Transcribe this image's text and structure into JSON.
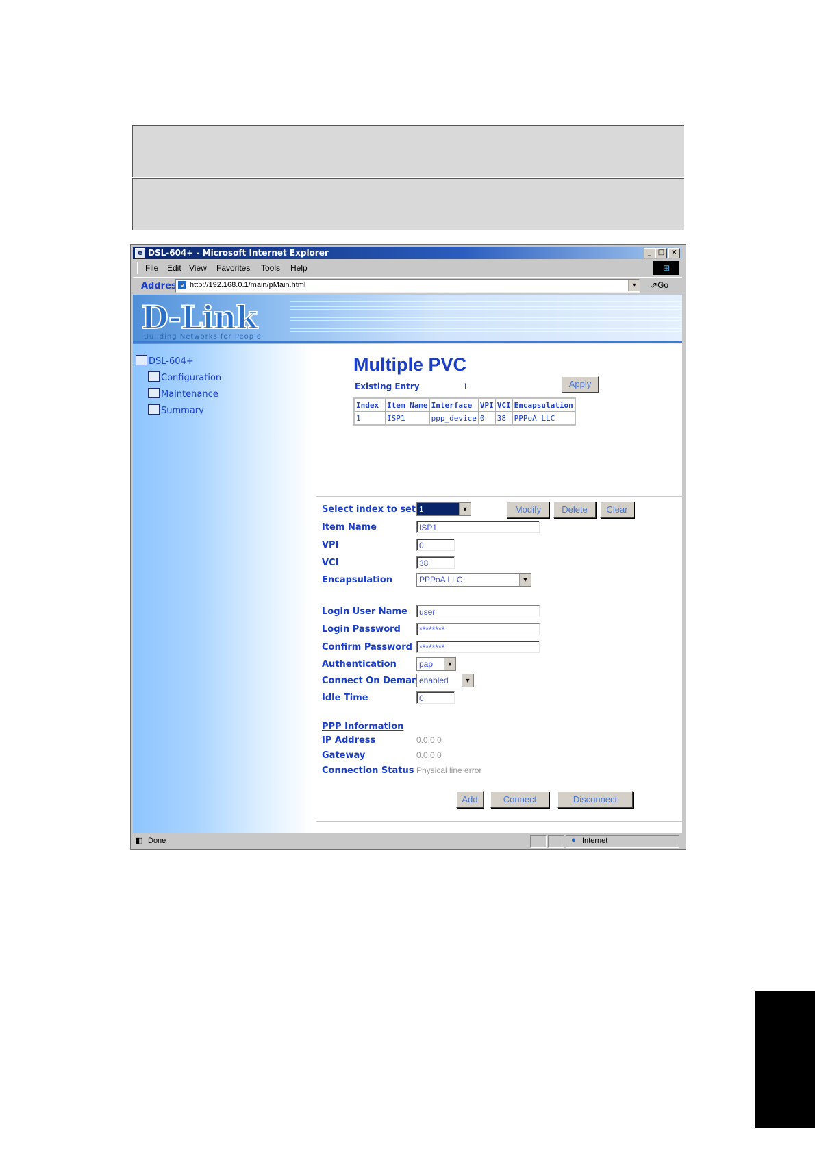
{
  "browser": {
    "title": "DSL-604+ - Microsoft Internet Explorer",
    "menu": [
      "File",
      "Edit",
      "View",
      "Favorites",
      "Tools",
      "Help"
    ],
    "address_label": "Address",
    "url": "http://192.168.0.1/main/pMain.html",
    "go_label": "Go",
    "status_left": "Done",
    "status_zone": "Internet"
  },
  "brand": {
    "logo": "D-Link",
    "tagline": "Building Networks for People"
  },
  "nav": {
    "root": "DSL-604+",
    "items": [
      "Configuration",
      "Maintenance",
      "Summary"
    ]
  },
  "page": {
    "title": "Multiple PVC",
    "existing_entry_label": "Existing Entry",
    "existing_entry_value": "1",
    "apply_label": "Apply"
  },
  "table": {
    "headers": [
      "Index",
      "Item Name",
      "Interface",
      "VPI",
      "VCI",
      "Encapsulation"
    ],
    "rows": [
      [
        "1",
        "ISP1",
        "ppp_device",
        "0",
        "38",
        "PPPoA LLC"
      ]
    ]
  },
  "form": {
    "select_index_label": "Select index to set",
    "select_index_value": "1",
    "modify_label": "Modify",
    "delete_label": "Delete",
    "clear_label": "Clear",
    "item_name_label": "Item Name",
    "item_name_value": "ISP1",
    "vpi_label": "VPI",
    "vpi_value": "0",
    "vci_label": "VCI",
    "vci_value": "38",
    "encapsulation_label": "Encapsulation",
    "encapsulation_value": "PPPoA LLC",
    "login_user_label": "Login User Name",
    "login_user_value": "user",
    "login_password_label": "Login Password",
    "login_password_value": "********",
    "confirm_password_label": "Confirm Password",
    "confirm_password_value": "********",
    "authentication_label": "Authentication",
    "authentication_value": "pap",
    "connect_on_demand_label": "Connect On Demand",
    "connect_on_demand_value": "enabled",
    "idle_time_label": "Idle Time",
    "idle_time_value": "0"
  },
  "ppp": {
    "heading": "PPP Information",
    "ip_label": "IP Address",
    "ip_value": "0.0.0.0",
    "gateway_label": "Gateway",
    "gateway_value": "0.0.0.0",
    "status_label": "Connection Status",
    "status_value": "Physical line error",
    "add_label": "Add",
    "connect_label": "Connect",
    "disconnect_label": "Disconnect"
  },
  "colors": {
    "accent": "#1a3ec8",
    "titlebar": "#0a246a",
    "page_bg": "#ffffff"
  }
}
